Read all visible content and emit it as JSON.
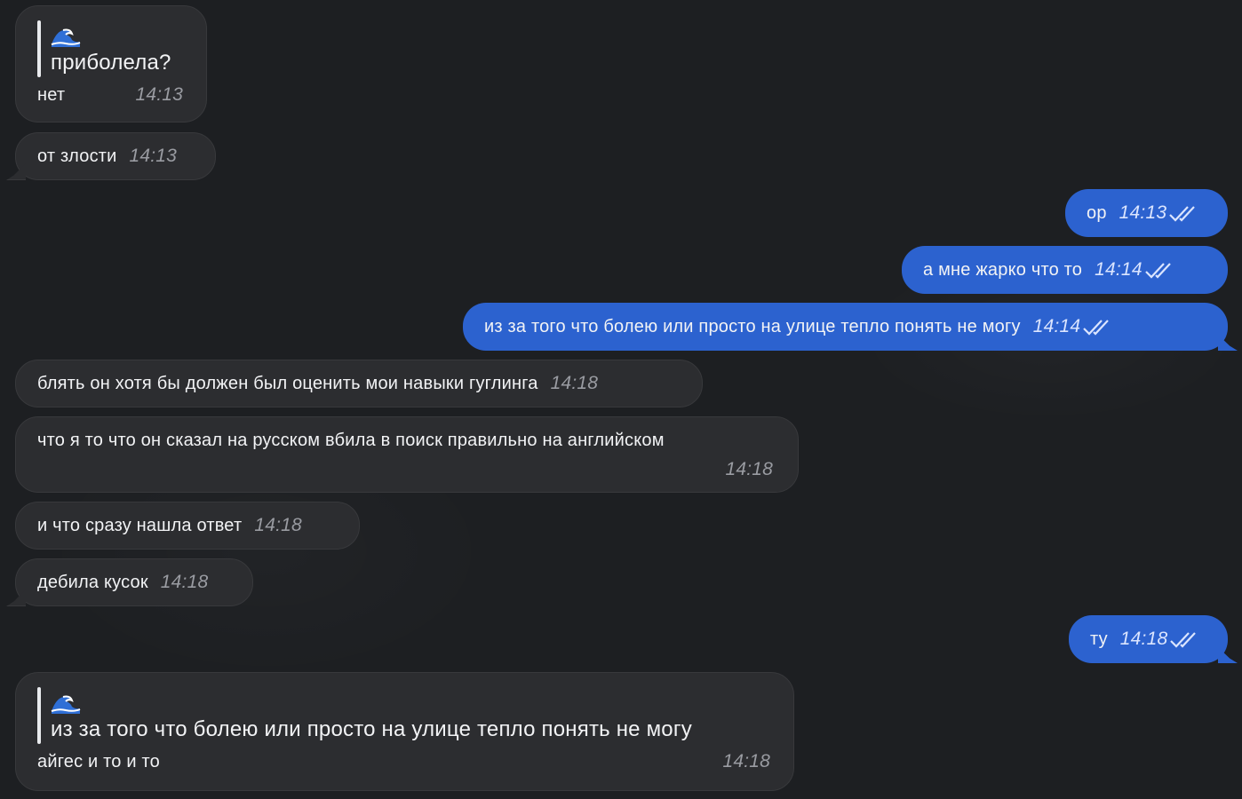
{
  "colors": {
    "background": "#1d1f22",
    "incoming_bubble": "#2c2d30",
    "outgoing_bubble": "#2c62cf",
    "text": "#f2f3f5",
    "time_incoming": "#9a9ca2",
    "time_outgoing": "#dbe5ff"
  },
  "messages": [
    {
      "direction": "in",
      "reply": {
        "quoted_icon": "wave-emoji-icon",
        "quoted_text": "приболела?"
      },
      "text": "нет",
      "time": "14:13"
    },
    {
      "direction": "in",
      "text": "от злости",
      "time": "14:13"
    },
    {
      "direction": "out",
      "text": "ор",
      "time": "14:13",
      "status_icon": "double-check-icon"
    },
    {
      "direction": "out",
      "text": "а мне жарко что то",
      "time": "14:14",
      "status_icon": "double-check-icon"
    },
    {
      "direction": "out",
      "text": "из за того что болею или просто на улице тепло понять не могу",
      "time": "14:14",
      "status_icon": "double-check-icon"
    },
    {
      "direction": "in",
      "text": "блять он хотя бы должен был оценить мои навыки гуглинга",
      "time": "14:18"
    },
    {
      "direction": "in",
      "text": "что я то что он сказал на русском вбила в поиск правильно на английском",
      "time": "14:18"
    },
    {
      "direction": "in",
      "text": "и что сразу нашла ответ",
      "time": "14:18"
    },
    {
      "direction": "in",
      "text": "дебила кусок",
      "time": "14:18"
    },
    {
      "direction": "out",
      "text": "ту",
      "time": "14:18",
      "status_icon": "double-check-icon"
    },
    {
      "direction": "in",
      "reply": {
        "quoted_icon": "wave-emoji-icon",
        "quoted_text": "из за того что болею или просто на улице тепло понять не могу"
      },
      "text": "айгес и то и то",
      "time": "14:18"
    }
  ]
}
